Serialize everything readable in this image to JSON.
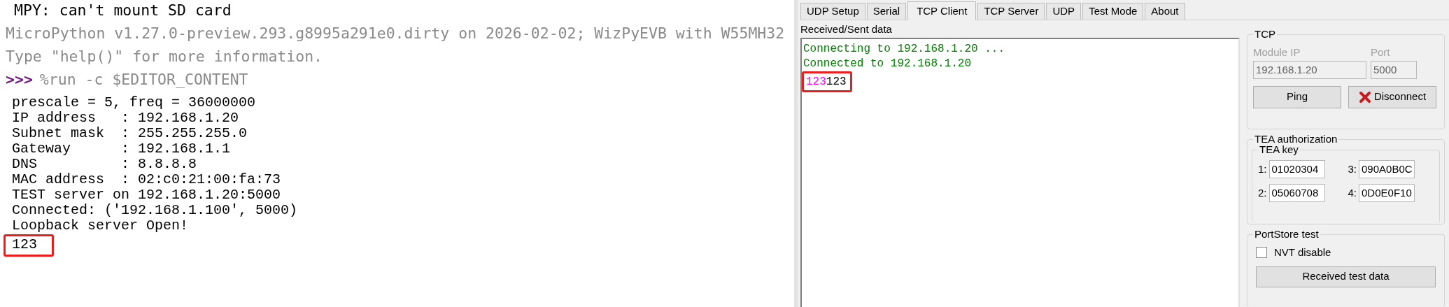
{
  "terminal": {
    "lines": [
      {
        "kind": "notice",
        "text": "MPY: can't mount SD card"
      },
      {
        "kind": "banner",
        "text": "MicroPython v1.27.0-preview.293.g8995a291e0.dirty on 2026-02-02; WizPyEVB with W55MH32"
      },
      {
        "kind": "banner",
        "text": "Type \"help()\" for more information."
      },
      {
        "kind": "prompt",
        "prompt": ">>>",
        "text": "%run -c $EDITOR_CONTENT"
      }
    ],
    "output": [
      {
        "text": "prescale = 5, freq = 36000000",
        "highlighted": false
      },
      {
        "text": "IP address   : 192.168.1.20",
        "highlighted": false
      },
      {
        "text": "Subnet mask  : 255.255.255.0",
        "highlighted": false
      },
      {
        "text": "Gateway      : 192.168.1.1",
        "highlighted": false
      },
      {
        "text": "DNS          : 8.8.8.8",
        "highlighted": false
      },
      {
        "text": "MAC address  : 02:c0:21:00:fa:73",
        "highlighted": false
      },
      {
        "text": "TEST server on 192.168.1.20:5000",
        "highlighted": false
      },
      {
        "text": "Connected: ('192.168.1.100', 5000)",
        "highlighted": false
      },
      {
        "text": "Loopback server Open!",
        "highlighted": false
      },
      {
        "text": "123",
        "highlighted": true
      }
    ]
  },
  "tool": {
    "tabs": [
      {
        "label": "UDP Setup",
        "selected": false
      },
      {
        "label": "Serial",
        "selected": false
      },
      {
        "label": "TCP Client",
        "selected": true
      },
      {
        "label": "TCP Server",
        "selected": false
      },
      {
        "label": "UDP",
        "selected": false
      },
      {
        "label": "Test Mode",
        "selected": false
      },
      {
        "label": "About",
        "selected": false
      }
    ],
    "data": {
      "label": "Received/Sent data",
      "lines": [
        {
          "highlighted": false,
          "segments": [
            {
              "text": "Connecting to 192.168.1.20 ...",
              "color": "#008000"
            }
          ]
        },
        {
          "highlighted": false,
          "segments": [
            {
              "text": "Connected to 192.168.1.20",
              "color": "#008000"
            }
          ]
        },
        {
          "highlighted": true,
          "segments": [
            {
              "text": "123",
              "color": "#ff00ff"
            },
            {
              "text": "123",
              "color": "#000000"
            }
          ]
        }
      ]
    },
    "tcp": {
      "title": "TCP",
      "fields": [
        {
          "label": "Module IP",
          "value": "192.168.1.20",
          "disabled": true
        },
        {
          "label": "Port",
          "value": "5000",
          "disabled": true
        }
      ],
      "ping": "Ping",
      "disconnect": "Disconnect"
    },
    "tea": {
      "title": "TEA authorization",
      "key_title": "TEA key",
      "keys": [
        {
          "label": "1:",
          "value": "01020304"
        },
        {
          "label": "3:",
          "value": "090A0B0C"
        },
        {
          "label": "2:",
          "value": "05060708"
        },
        {
          "label": "4:",
          "value": "0D0E0F10"
        }
      ]
    },
    "portstore": {
      "title": "PortStore test",
      "nvt": {
        "label": "NVT disable",
        "checked": false
      },
      "button": "Received test data"
    }
  }
}
